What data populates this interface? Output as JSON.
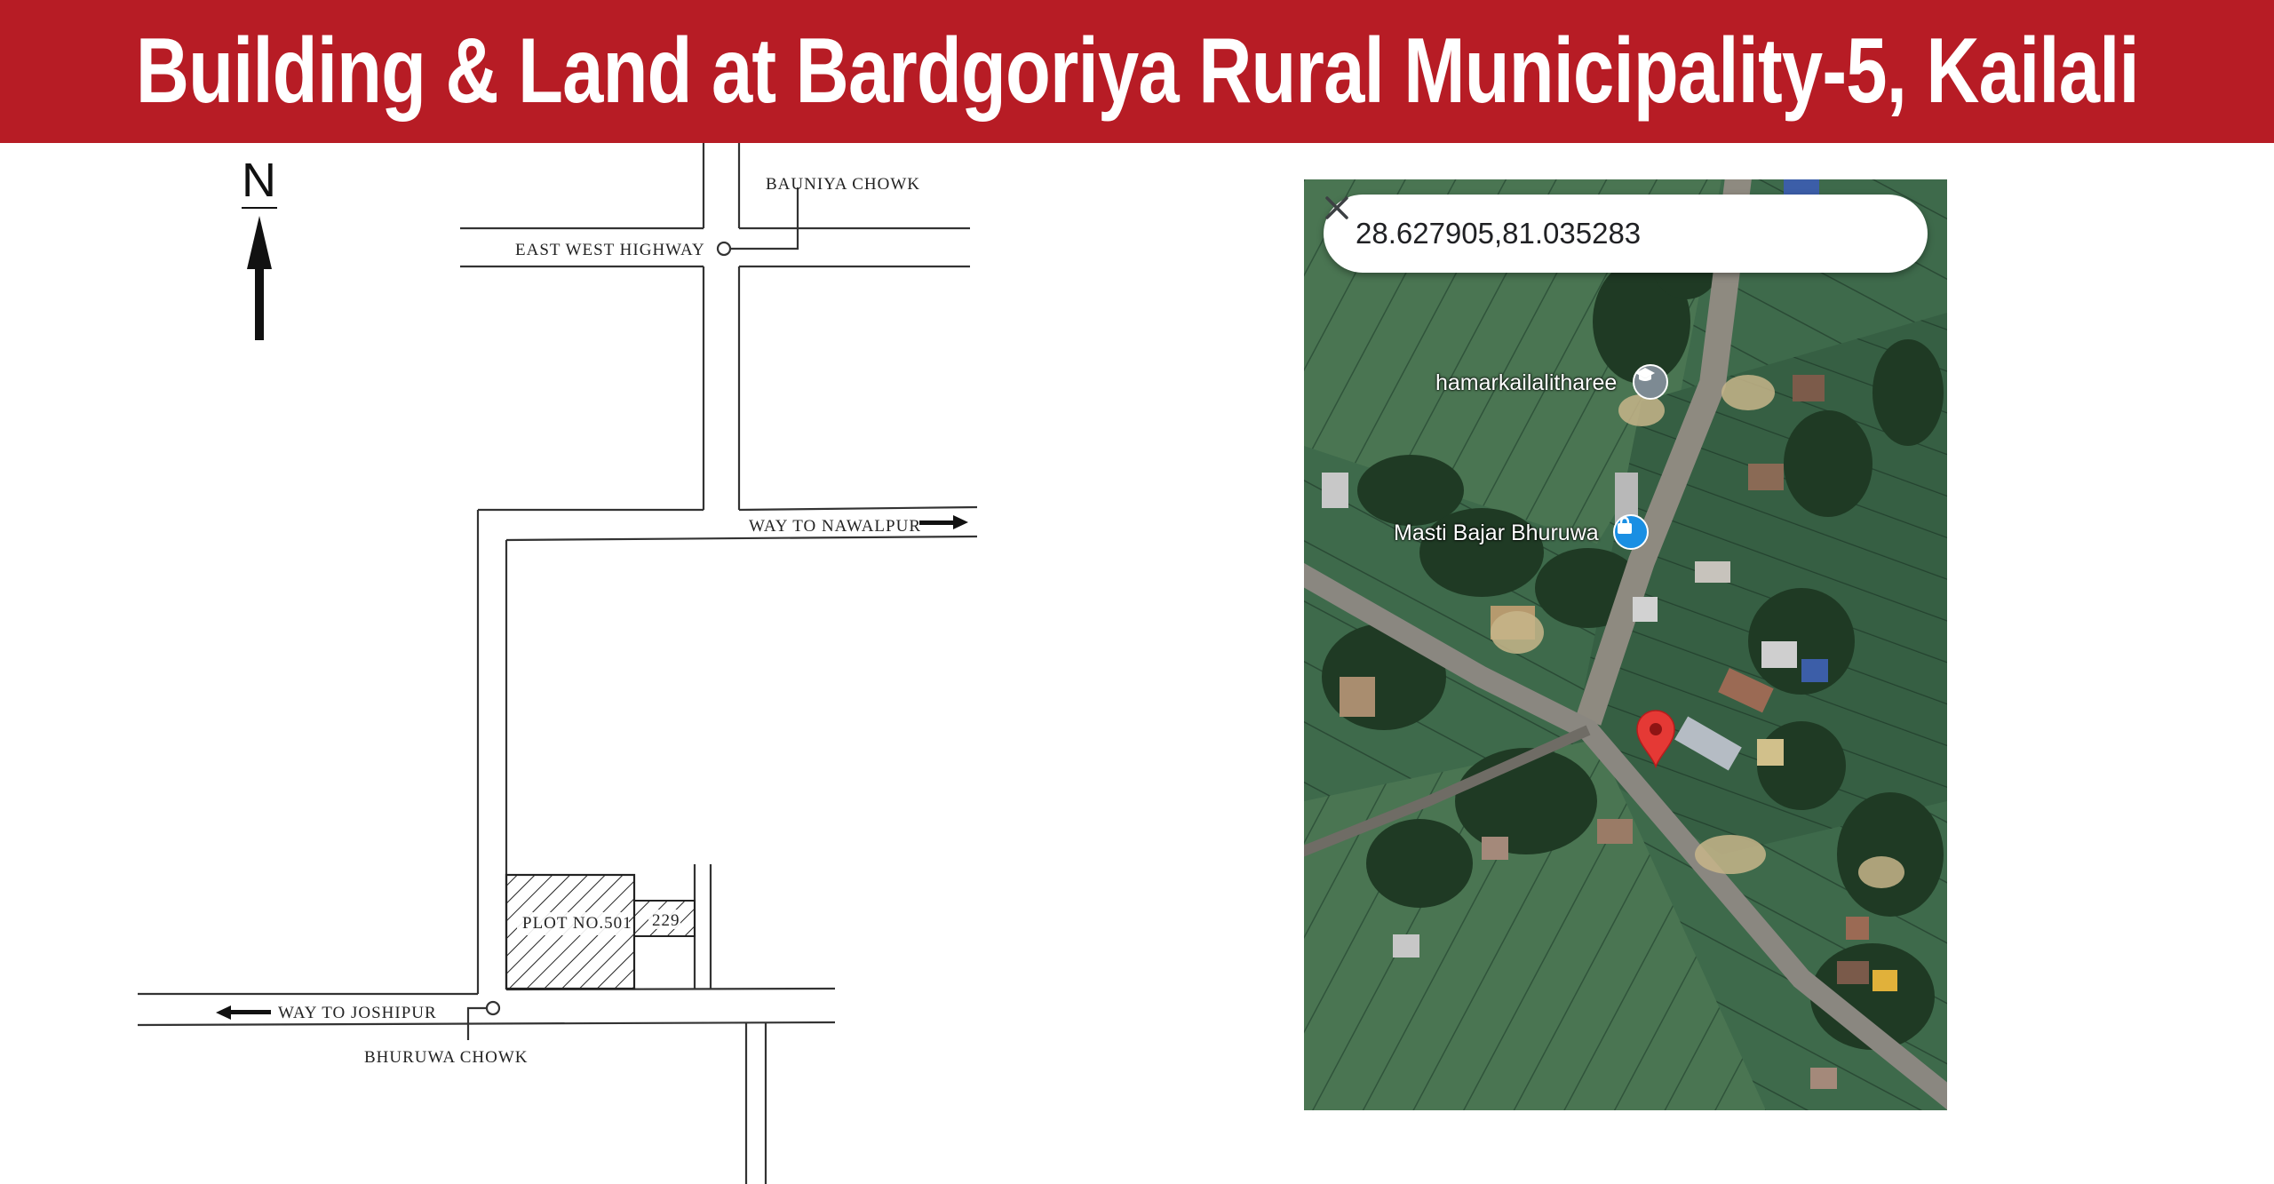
{
  "banner": {
    "title": "Building & Land at Bardgoriya Rural Municipality-5, Kailali",
    "background_color": "#b71c25"
  },
  "sketch_map": {
    "north_label": "N",
    "labels": {
      "bauniya_chowk": "BAUNIYA CHOWK",
      "east_west_highway": "EAST WEST HIGHWAY",
      "way_to_nawalpur": "WAY TO NAWALPUR",
      "plot": "PLOT NO.501",
      "plot_adjacent": "229",
      "way_to_joshipur": "WAY TO JOSHIPUR",
      "bhuruwa_chowk": "BHURUWA CHOWK"
    }
  },
  "satellite_map": {
    "search_value": "28.627905,81.035283",
    "close_icon": "close-icon",
    "places": [
      {
        "name": "hamarkailalitharee",
        "icon": "school-icon",
        "icon_color": "#7d8a93"
      },
      {
        "name": "Masti Bajar Bhuruwa",
        "icon": "shopping-bag-icon",
        "icon_color": "#1a8fe3"
      }
    ],
    "pin_color": "#e53935"
  }
}
